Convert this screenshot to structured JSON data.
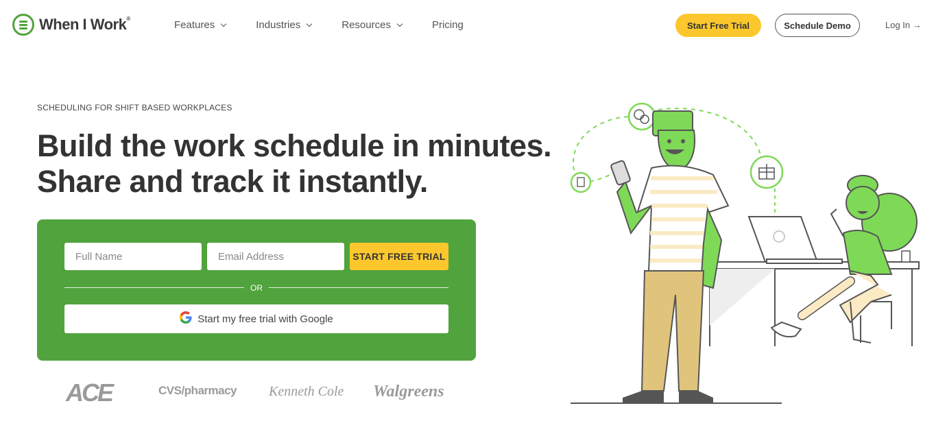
{
  "header": {
    "logo_text": "When I Work",
    "logo_mark": "®",
    "nav": [
      {
        "label": "Features"
      },
      {
        "label": "Industries"
      },
      {
        "label": "Resources"
      },
      {
        "label": "Pricing"
      }
    ],
    "trial_label": "Start Free Trial",
    "demo_label": "Schedule Demo",
    "login_label": "Log In →"
  },
  "hero": {
    "eyebrow": "SCHEDULING FOR SHIFT BASED WORKPLACES",
    "headline_line1": "Build the work schedule in minutes.",
    "headline_line2": "Share and track it instantly."
  },
  "signup": {
    "name_placeholder": "Full Name",
    "email_placeholder": "Email Address",
    "submit_label": "START FREE TRIAL",
    "or_label": "OR",
    "google_label": "Start my free trial with Google"
  },
  "brands": {
    "ace": "ACE",
    "cvs": "CVS/pharmacy",
    "kenneth_cole": "Kenneth Cole",
    "walgreens": "Walgreens"
  },
  "colors": {
    "brand_green": "#51a33d",
    "accent_yellow": "#fbc72d",
    "illustration_green": "#7ed957"
  }
}
